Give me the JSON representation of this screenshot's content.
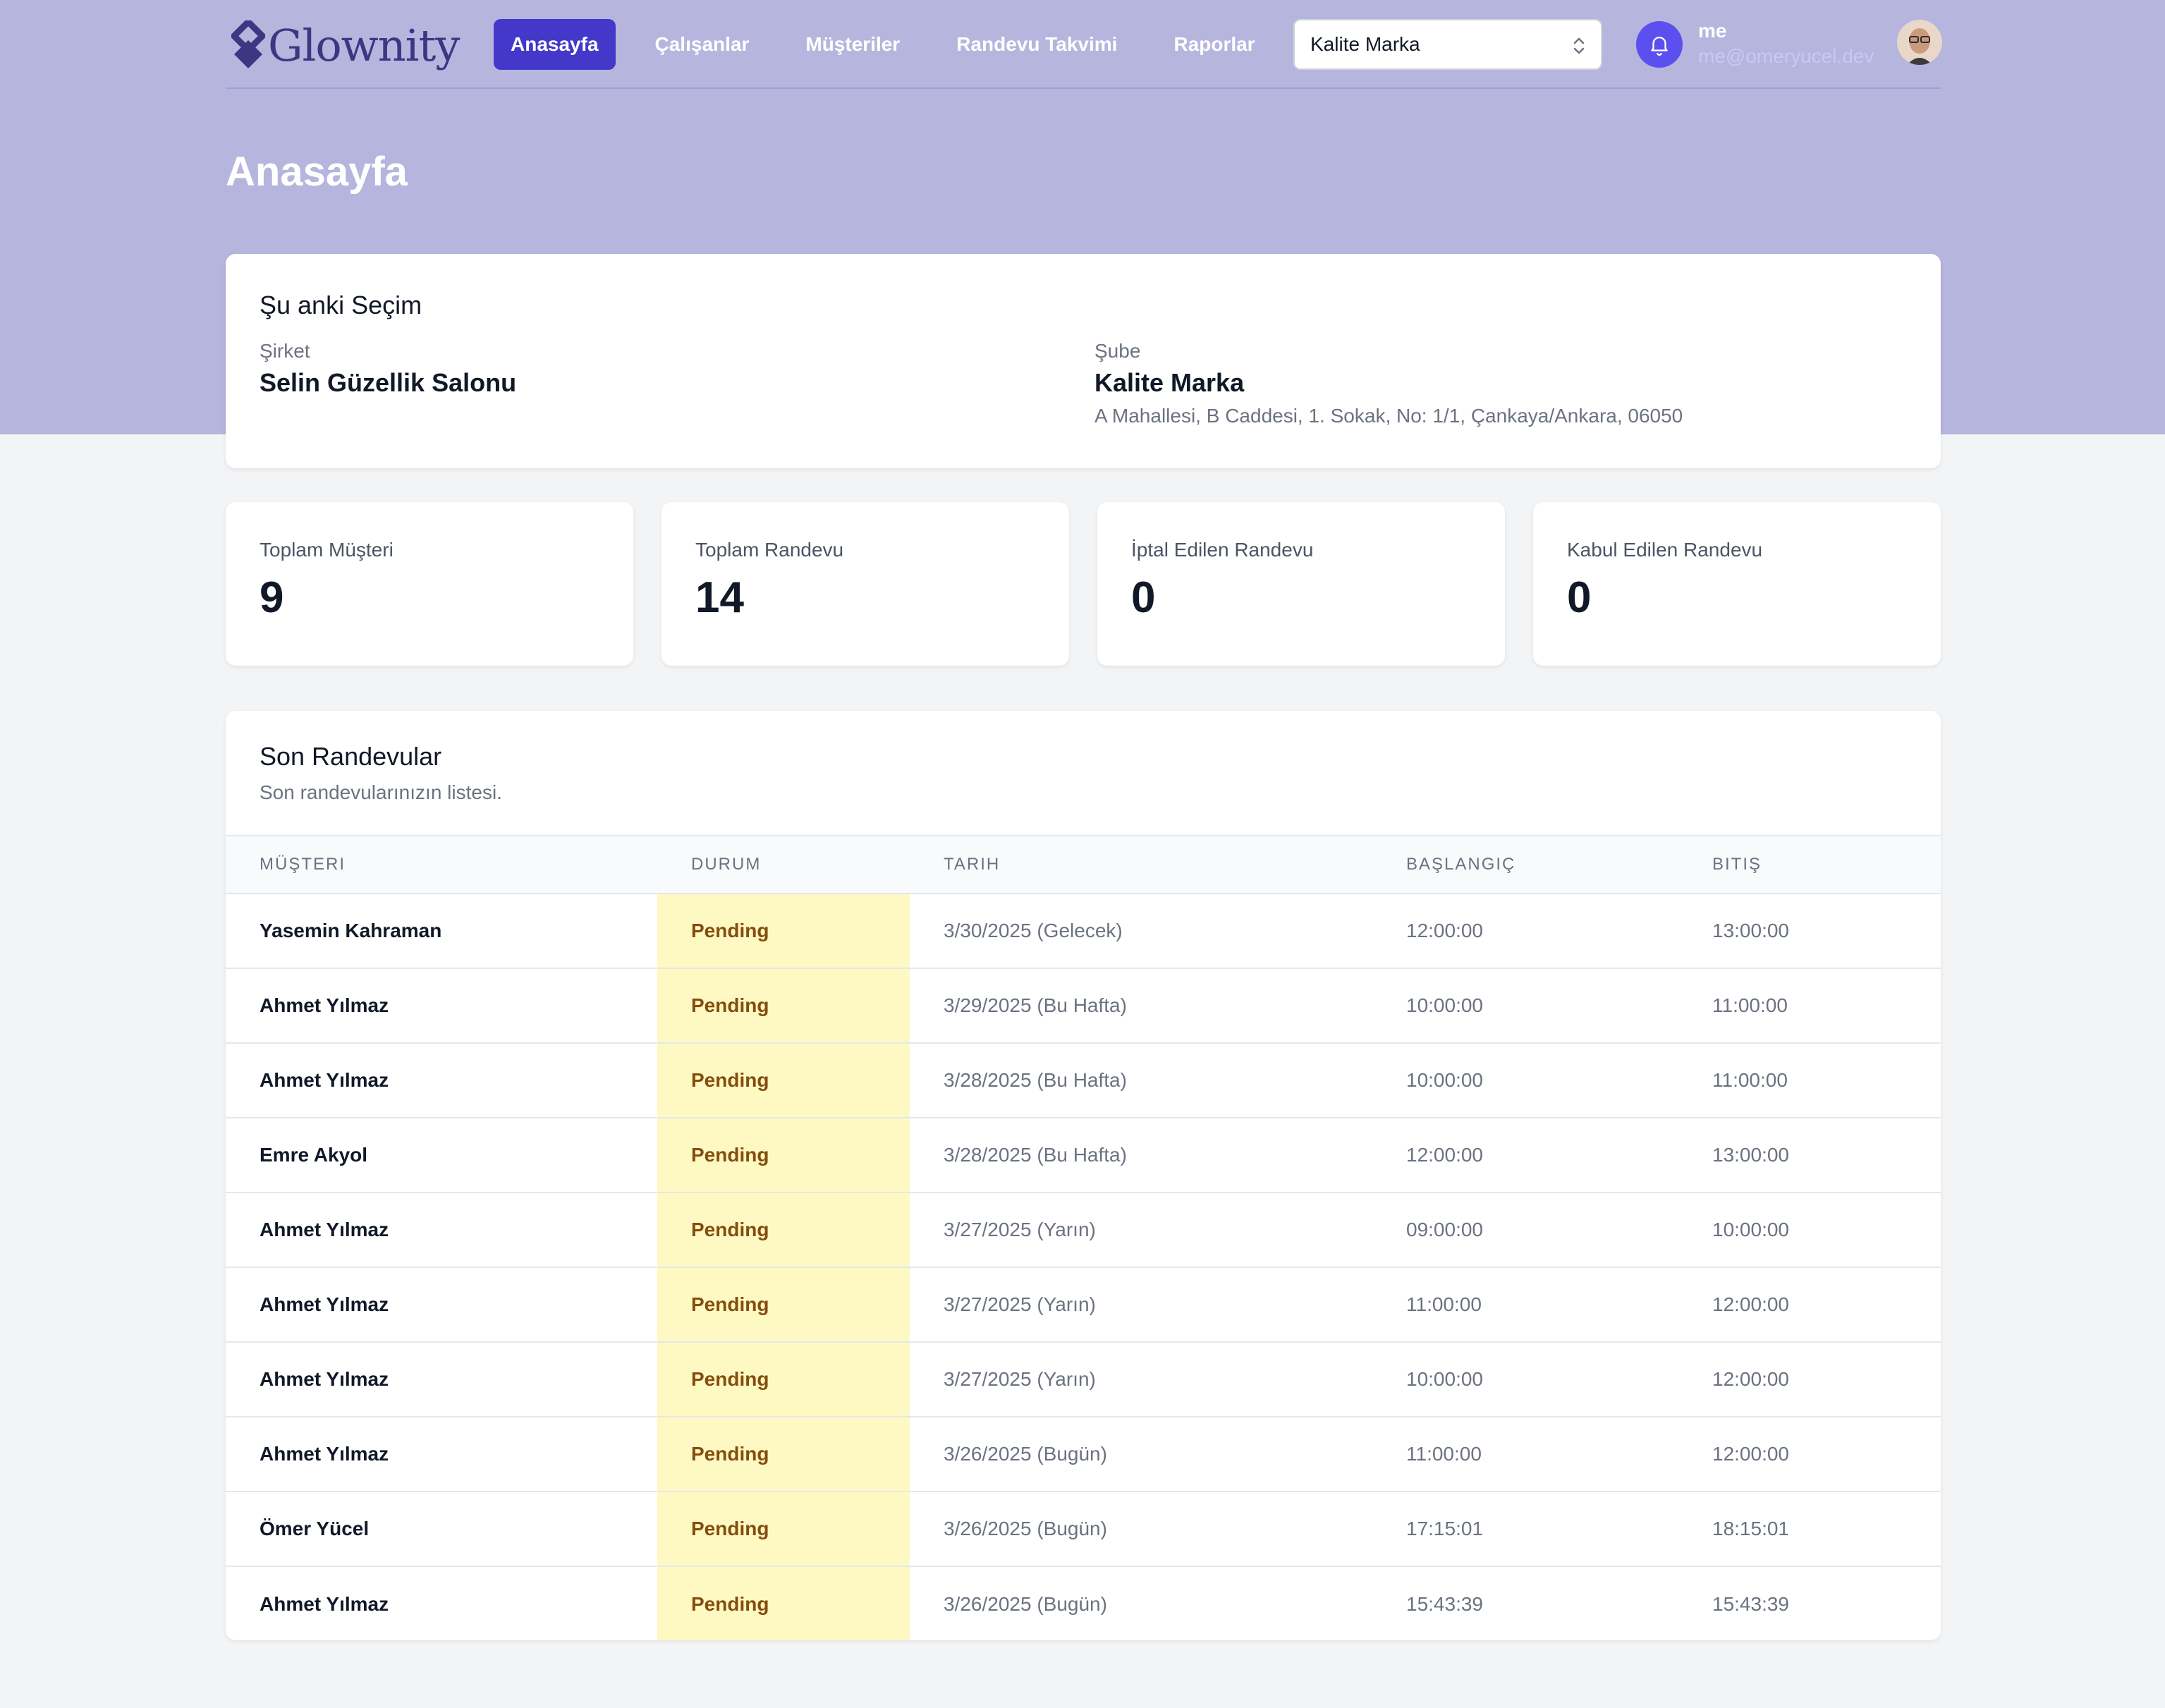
{
  "app": {
    "brand": "Glownity"
  },
  "nav": {
    "items": [
      {
        "label": "Anasayfa",
        "active": true
      },
      {
        "label": "Çalışanlar"
      },
      {
        "label": "Müşteriler"
      },
      {
        "label": "Randevu Takvimi"
      },
      {
        "label": "Raporlar"
      }
    ],
    "branch_select": "Kalite Marka"
  },
  "user": {
    "name": "me",
    "email": "me@omeryucel.dev"
  },
  "page": {
    "title": "Anasayfa"
  },
  "selection": {
    "title": "Şu anki Seçim",
    "company_label": "Şirket",
    "company": "Selin Güzellik Salonu",
    "branch_label": "Şube",
    "branch": "Kalite Marka",
    "address": "A Mahallesi, B Caddesi, 1. Sokak, No: 1/1, Çankaya/Ankara, 06050"
  },
  "stats": [
    {
      "label": "Toplam Müşteri",
      "value": "9"
    },
    {
      "label": "Toplam Randevu",
      "value": "14"
    },
    {
      "label": "İptal Edilen Randevu",
      "value": "0"
    },
    {
      "label": "Kabul Edilen Randevu",
      "value": "0"
    }
  ],
  "recent": {
    "title": "Son Randevular",
    "subtitle": "Son randevularınızın listesi.",
    "columns": [
      "MÜŞTERI",
      "DURUM",
      "TARIH",
      "BAŞLANGIÇ",
      "BITIŞ"
    ],
    "rows": [
      {
        "customer": "Yasemin Kahraman",
        "status": "Pending",
        "date": "3/30/2025 (Gelecek)",
        "start": "12:00:00",
        "end": "13:00:00"
      },
      {
        "customer": "Ahmet Yılmaz",
        "status": "Pending",
        "date": "3/29/2025 (Bu Hafta)",
        "start": "10:00:00",
        "end": "11:00:00"
      },
      {
        "customer": "Ahmet Yılmaz",
        "status": "Pending",
        "date": "3/28/2025 (Bu Hafta)",
        "start": "10:00:00",
        "end": "11:00:00"
      },
      {
        "customer": "Emre Akyol",
        "status": "Pending",
        "date": "3/28/2025 (Bu Hafta)",
        "start": "12:00:00",
        "end": "13:00:00"
      },
      {
        "customer": "Ahmet Yılmaz",
        "status": "Pending",
        "date": "3/27/2025 (Yarın)",
        "start": "09:00:00",
        "end": "10:00:00"
      },
      {
        "customer": "Ahmet Yılmaz",
        "status": "Pending",
        "date": "3/27/2025 (Yarın)",
        "start": "11:00:00",
        "end": "12:00:00"
      },
      {
        "customer": "Ahmet Yılmaz",
        "status": "Pending",
        "date": "3/27/2025 (Yarın)",
        "start": "10:00:00",
        "end": "12:00:00"
      },
      {
        "customer": "Ahmet Yılmaz",
        "status": "Pending",
        "date": "3/26/2025 (Bugün)",
        "start": "11:00:00",
        "end": "12:00:00"
      },
      {
        "customer": "Ömer Yücel",
        "status": "Pending",
        "date": "3/26/2025 (Bugün)",
        "start": "17:15:01",
        "end": "18:15:01"
      },
      {
        "customer": "Ahmet Yılmaz",
        "status": "Pending",
        "date": "3/26/2025 (Bugün)",
        "start": "15:43:39",
        "end": "15:43:39"
      }
    ]
  },
  "colors": {
    "hero": "#b6b5dd",
    "accent": "#4338ca",
    "pending_bg": "#fef9c3",
    "pending_text": "#854d0e"
  },
  "icons": {
    "logo": "diamond-logo-icon",
    "bell": "bell-icon",
    "select": "chevron-up-down-icon"
  }
}
